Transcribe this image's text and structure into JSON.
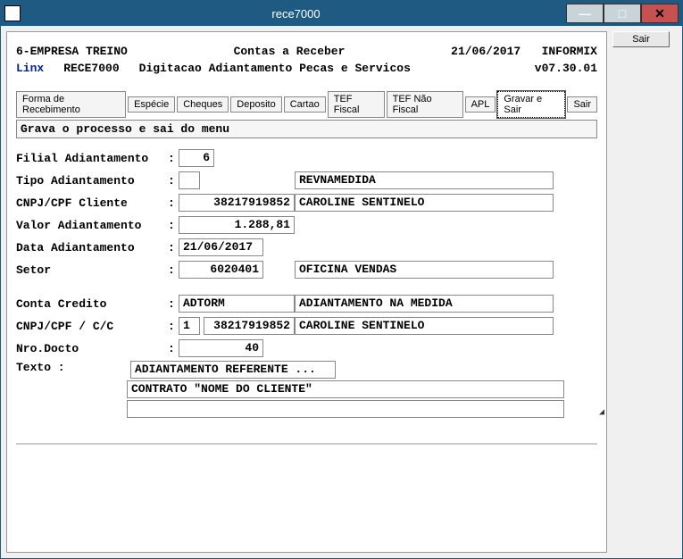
{
  "window": {
    "title": "rece7000",
    "min": "—",
    "max": "□",
    "close": "✕"
  },
  "right": {
    "sair": "Sair"
  },
  "header": {
    "company": "6-EMPRESA TREINO",
    "screen_title": "Contas a Receber",
    "date": "21/06/2017",
    "db": "INFORMIX",
    "vendor": "Linx",
    "program": "RECE7000",
    "subtitle": "Digitacao  Adiantamento Pecas e Servicos",
    "version": "v07.30.01"
  },
  "tabs": {
    "t1": "Forma de Recebimento",
    "t2": "Espécie",
    "t3": "Cheques",
    "t4": "Deposito",
    "t5": "Cartao",
    "t6": "TEF Fiscal",
    "t7": "TEF Não Fiscal",
    "t8": "APL",
    "t9": "Gravar e Sair",
    "t10": "Sair"
  },
  "help": "Grava o processo e sai do menu",
  "form": {
    "filial_lbl": "Filial Adiantamento",
    "filial_val": "6",
    "tipo_lbl": "Tipo  Adiantamento ",
    "tipo_val": "",
    "tipo_desc": "REVNAMEDIDA",
    "cnpj_cli_lbl": "CNPJ/CPF Cliente   ",
    "cnpj_cli_val": "38217919852",
    "cnpj_cli_desc": "CAROLINE SENTINELO",
    "valor_lbl": "Valor Adiantamento ",
    "valor_val": "1.288,81",
    "data_lbl": "Data  Adiantamento ",
    "data_val": "21/06/2017",
    "setor_lbl": "Setor              ",
    "setor_val": "6020401",
    "setor_desc": "OFICINA VENDAS",
    "conta_lbl": "Conta Credito      ",
    "conta_val": "ADTORM",
    "conta_desc": "ADIANTAMENTO NA MEDIDA",
    "cc_lbl": "CNPJ/CPF / C/C     ",
    "cc_col1": "1",
    "cc_col2": "38217919852",
    "cc_desc": "CAROLINE SENTINELO",
    "nro_lbl": "Nro.Docto          ",
    "nro_val": "40",
    "texto_lbl": "Texto :",
    "texto1": "ADIANTAMENTO REFERENTE ...",
    "texto2": "CONTRATO \"NOME DO CLIENTE\"",
    "texto3": ""
  },
  "colon": ":"
}
